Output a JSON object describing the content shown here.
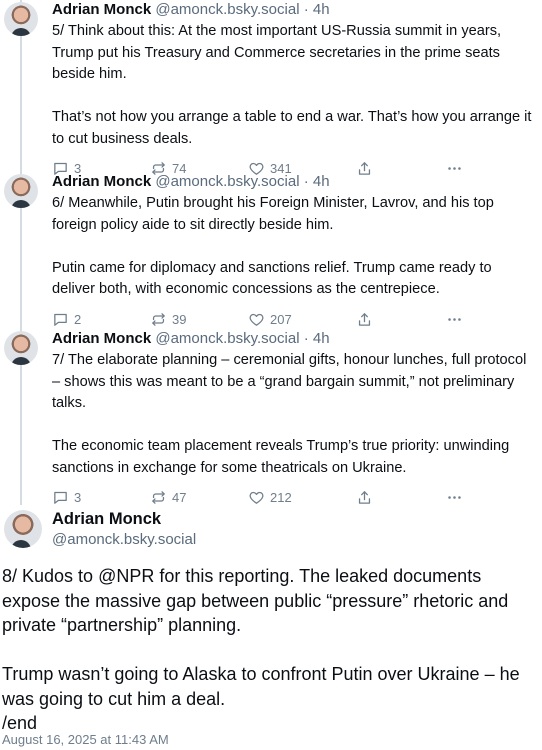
{
  "posts": [
    {
      "name": "Adrian Monck",
      "handle": "@amonck.bsky.social",
      "separator": "·",
      "time": "4h",
      "paragraphs": [
        "5/ Think about this: At the most important US-Russia summit in years, Trump put his Treasury and Commerce secretaries in the prime seats beside him.",
        "That’s not how you arrange a table to end a war. That’s how you arrange it to cut business deals."
      ],
      "replies": "3",
      "reposts": "74",
      "likes": "341"
    },
    {
      "name": "Adrian Monck",
      "handle": "@amonck.bsky.social",
      "separator": "·",
      "time": "4h",
      "paragraphs": [
        "6/ Meanwhile, Putin brought his Foreign Minister, Lavrov, and his top foreign policy aide to sit directly beside him.",
        "Putin came for diplomacy and sanctions relief. Trump came ready to deliver both, with economic concessions as the centrepiece."
      ],
      "replies": "2",
      "reposts": "39",
      "likes": "207"
    },
    {
      "name": "Adrian Monck",
      "handle": "@amonck.bsky.social",
      "separator": "·",
      "time": "4h",
      "paragraphs": [
        "7/ The elaborate planning – ceremonial gifts, honour lunches, full protocol – shows this was meant to be a “grand bargain summit,” not preliminary talks.",
        "The economic team placement reveals Trump’s true priority: unwinding sanctions in exchange for some theatricals on Ukraine."
      ],
      "replies": "3",
      "reposts": "47",
      "likes": "212"
    }
  ],
  "main_post": {
    "name": "Adrian Monck",
    "handle": "@amonck.bsky.social",
    "paragraphs": [
      "8/ Kudos to @NPR for this reporting. The leaked documents expose the massive gap between public “pressure” rhetoric and private “partnership” planning.",
      "Trump wasn’t going to Alaska to confront Putin over Ukraine – he was going to cut him a deal.\n/end"
    ],
    "timestamp": "August 16, 2025 at 11:43 AM"
  },
  "icons": {
    "reply": "speech-bubble-icon",
    "repost": "repost-arrows-icon",
    "like": "heart-icon",
    "share": "share-upload-icon",
    "more": "ellipsis-icon"
  },
  "colors": {
    "text": "#0b0f14",
    "muted": "#5a6b7c",
    "icon": "#6f7e8c",
    "thread_line": "#d4dbe2"
  }
}
